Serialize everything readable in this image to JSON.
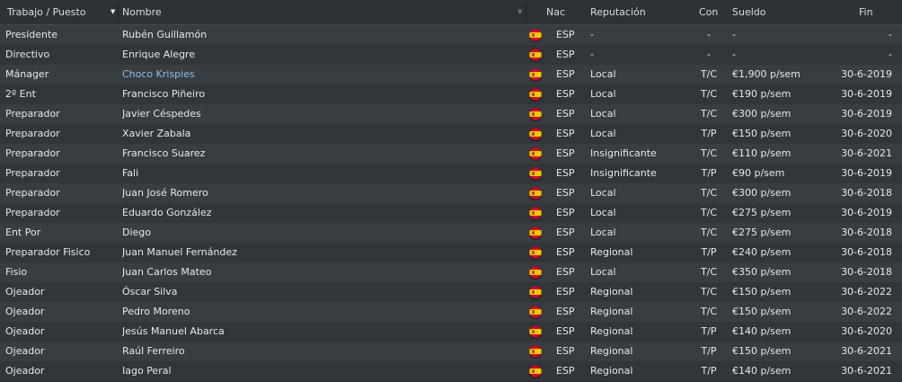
{
  "header": {
    "job": "Trabajo / Puesto",
    "name": "Nombre",
    "nat": "Nac",
    "rep": "Reputación",
    "con": "Con",
    "salary": "Sueldo",
    "end": "Fin"
  },
  "rows": [
    {
      "job": "Presidente",
      "name": "Rubén Guillamón",
      "nat": "ESP",
      "rep": "-",
      "con": "-",
      "salary": "-",
      "end": "-"
    },
    {
      "job": "Directivo",
      "name": "Enrique Alegre",
      "nat": "ESP",
      "rep": "-",
      "con": "-",
      "salary": "-",
      "end": "-"
    },
    {
      "job": "Mánager",
      "name": "Choco Krispies",
      "nat": "ESP",
      "rep": "Local",
      "con": "T/C",
      "salary": "€1,900 p/sem",
      "end": "30-6-2019"
    },
    {
      "job": "2º Ent",
      "name": "Francisco Piñeiro",
      "nat": "ESP",
      "rep": "Local",
      "con": "T/C",
      "salary": "€190 p/sem",
      "end": "30-6-2019"
    },
    {
      "job": "Preparador",
      "name": "Javier Céspedes",
      "nat": "ESP",
      "rep": "Local",
      "con": "T/C",
      "salary": "€300 p/sem",
      "end": "30-6-2019"
    },
    {
      "job": "Preparador",
      "name": "Xavier Zabala",
      "nat": "ESP",
      "rep": "Local",
      "con": "T/P",
      "salary": "€150 p/sem",
      "end": "30-6-2020"
    },
    {
      "job": "Preparador",
      "name": "Francisco Suarez",
      "nat": "ESP",
      "rep": "Insignificante",
      "con": "T/C",
      "salary": "€110 p/sem",
      "end": "30-6-2021"
    },
    {
      "job": "Preparador",
      "name": "Fali",
      "nat": "ESP",
      "rep": "Insignificante",
      "con": "T/P",
      "salary": "€90 p/sem",
      "end": "30-6-2019"
    },
    {
      "job": "Preparador",
      "name": "Juan José Romero",
      "nat": "ESP",
      "rep": "Local",
      "con": "T/C",
      "salary": "€300 p/sem",
      "end": "30-6-2018"
    },
    {
      "job": "Preparador",
      "name": "Eduardo González",
      "nat": "ESP",
      "rep": "Local",
      "con": "T/C",
      "salary": "€275 p/sem",
      "end": "30-6-2019"
    },
    {
      "job": "Ent Por",
      "name": "Diego",
      "nat": "ESP",
      "rep": "Local",
      "con": "T/C",
      "salary": "€275 p/sem",
      "end": "30-6-2018"
    },
    {
      "job": "Preparador Fisico",
      "name": "Juan Manuel Fernández",
      "nat": "ESP",
      "rep": "Regional",
      "con": "T/P",
      "salary": "€240 p/sem",
      "end": "30-6-2018"
    },
    {
      "job": "Fisio",
      "name": "Juan Carlos Mateo",
      "nat": "ESP",
      "rep": "Local",
      "con": "T/C",
      "salary": "€350 p/sem",
      "end": "30-6-2018"
    },
    {
      "job": "Ojeador",
      "name": "Óscar Silva",
      "nat": "ESP",
      "rep": "Regional",
      "con": "T/C",
      "salary": "€150 p/sem",
      "end": "30-6-2022"
    },
    {
      "job": "Ojeador",
      "name": "Pedro Moreno",
      "nat": "ESP",
      "rep": "Regional",
      "con": "T/C",
      "salary": "€150 p/sem",
      "end": "30-6-2022"
    },
    {
      "job": "Ojeador",
      "name": "Jesús Manuel Abarca",
      "nat": "ESP",
      "rep": "Regional",
      "con": "T/P",
      "salary": "€140 p/sem",
      "end": "30-6-2020"
    },
    {
      "job": "Ojeador",
      "name": "Raúl Ferreiro",
      "nat": "ESP",
      "rep": "Regional",
      "con": "T/P",
      "salary": "€150 p/sem",
      "end": "30-6-2021"
    },
    {
      "job": "Ojeador",
      "name": "Iago Peral",
      "nat": "ESP",
      "rep": "Regional",
      "con": "T/P",
      "salary": "€140 p/sem",
      "end": "30-6-2021"
    }
  ],
  "highlight_row": 2,
  "flag_icon": "spain-flag-icon",
  "colors": {
    "link": "#8fbce6",
    "row_even": "#383d42",
    "row_odd": "#31363a"
  }
}
